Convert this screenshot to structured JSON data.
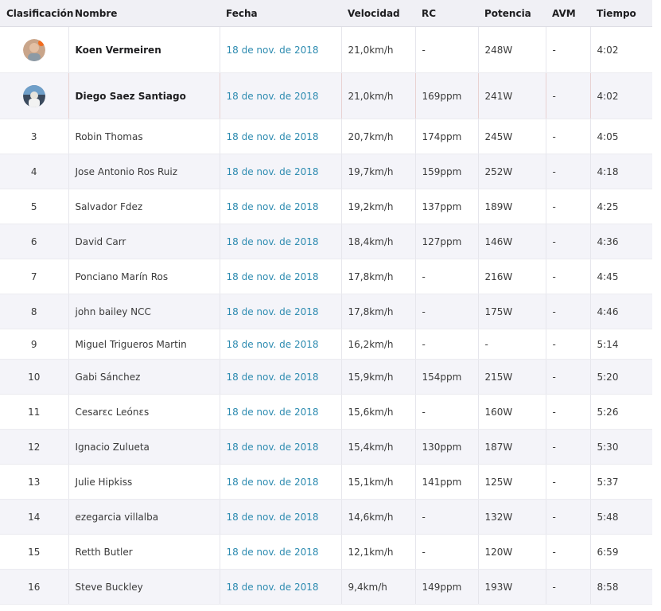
{
  "headers": {
    "rank": "Clasificación",
    "name": "Nombre",
    "date": "Fecha",
    "speed": "Velocidad",
    "rc": "RC",
    "power": "Potencia",
    "avm": "AVM",
    "time": "Tiempo"
  },
  "rows": [
    {
      "rank": "",
      "name": "Koen Vermeiren",
      "date": "18 de nov. de 2018",
      "speed": "21,0km/h",
      "rc": "-",
      "power": "248W",
      "avm": "-",
      "time": "4:02"
    },
    {
      "rank": "",
      "name": "Diego Saez Santiago",
      "date": "18 de nov. de 2018",
      "speed": "21,0km/h",
      "rc": "169ppm",
      "power": "241W",
      "avm": "-",
      "time": "4:02"
    },
    {
      "rank": "3",
      "name": "Robin Thomas",
      "date": "18 de nov. de 2018",
      "speed": "20,7km/h",
      "rc": "174ppm",
      "power": "245W",
      "avm": "-",
      "time": "4:05"
    },
    {
      "rank": "4",
      "name": "Jose Antonio Ros Ruiz",
      "date": "18 de nov. de 2018",
      "speed": "19,7km/h",
      "rc": "159ppm",
      "power": "252W",
      "avm": "-",
      "time": "4:18"
    },
    {
      "rank": "5",
      "name": "Salvador Fdez",
      "date": "18 de nov. de 2018",
      "speed": "19,2km/h",
      "rc": "137ppm",
      "power": "189W",
      "avm": "-",
      "time": "4:25"
    },
    {
      "rank": "6",
      "name": "David Carr",
      "date": "18 de nov. de 2018",
      "speed": "18,4km/h",
      "rc": "127ppm",
      "power": "146W",
      "avm": "-",
      "time": "4:36"
    },
    {
      "rank": "7",
      "name": "Ponciano Marín Ros",
      "date": "18 de nov. de 2018",
      "speed": "17,8km/h",
      "rc": "-",
      "power": "216W",
      "avm": "-",
      "time": "4:45"
    },
    {
      "rank": "8",
      "name": "john bailey NCC",
      "date": "18 de nov. de 2018",
      "speed": "17,8km/h",
      "rc": "-",
      "power": "175W",
      "avm": "-",
      "time": "4:46"
    },
    {
      "rank": "9",
      "name": "Miguel Trigueros Martin",
      "date": "18 de nov. de 2018",
      "speed": "16,2km/h",
      "rc": "-",
      "power": "-",
      "avm": "-",
      "time": "5:14"
    },
    {
      "rank": "10",
      "name": "Gabi Sánchez",
      "date": "18 de nov. de 2018",
      "speed": "15,9km/h",
      "rc": "154ppm",
      "power": "215W",
      "avm": "-",
      "time": "5:20"
    },
    {
      "rank": "11",
      "name": "Cesarεc Leónεs",
      "date": "18 de nov. de 2018",
      "speed": "15,6km/h",
      "rc": "-",
      "power": "160W",
      "avm": "-",
      "time": "5:26"
    },
    {
      "rank": "12",
      "name": "Ignacio Zulueta",
      "date": "18 de nov. de 2018",
      "speed": "15,4km/h",
      "rc": "130ppm",
      "power": "187W",
      "avm": "-",
      "time": "5:30"
    },
    {
      "rank": "13",
      "name": "Julie Hipkiss",
      "date": "18 de nov. de 2018",
      "speed": "15,1km/h",
      "rc": "141ppm",
      "power": "125W",
      "avm": "-",
      "time": "5:37"
    },
    {
      "rank": "14",
      "name": "ezegarcia villalba",
      "date": "18 de nov. de 2018",
      "speed": "14,6km/h",
      "rc": "-",
      "power": "132W",
      "avm": "-",
      "time": "5:48"
    },
    {
      "rank": "15",
      "name": "Retth Butler",
      "date": "18 de nov. de 2018",
      "speed": "12,1km/h",
      "rc": "-",
      "power": "120W",
      "avm": "-",
      "time": "6:59"
    },
    {
      "rank": "16",
      "name": "Steve Buckley",
      "date": "18 de nov. de 2018",
      "speed": "9,4km/h",
      "rc": "149ppm",
      "power": "193W",
      "avm": "-",
      "time": "8:58"
    }
  ],
  "icons": {
    "rank_1": "medal-avatar-icon",
    "rank_2": "medal-avatar-icon"
  },
  "colors": {
    "date_link": "#2d8bb0",
    "header_bg": "#f0f0f5",
    "alt_row_bg": "#f4f4f9"
  }
}
